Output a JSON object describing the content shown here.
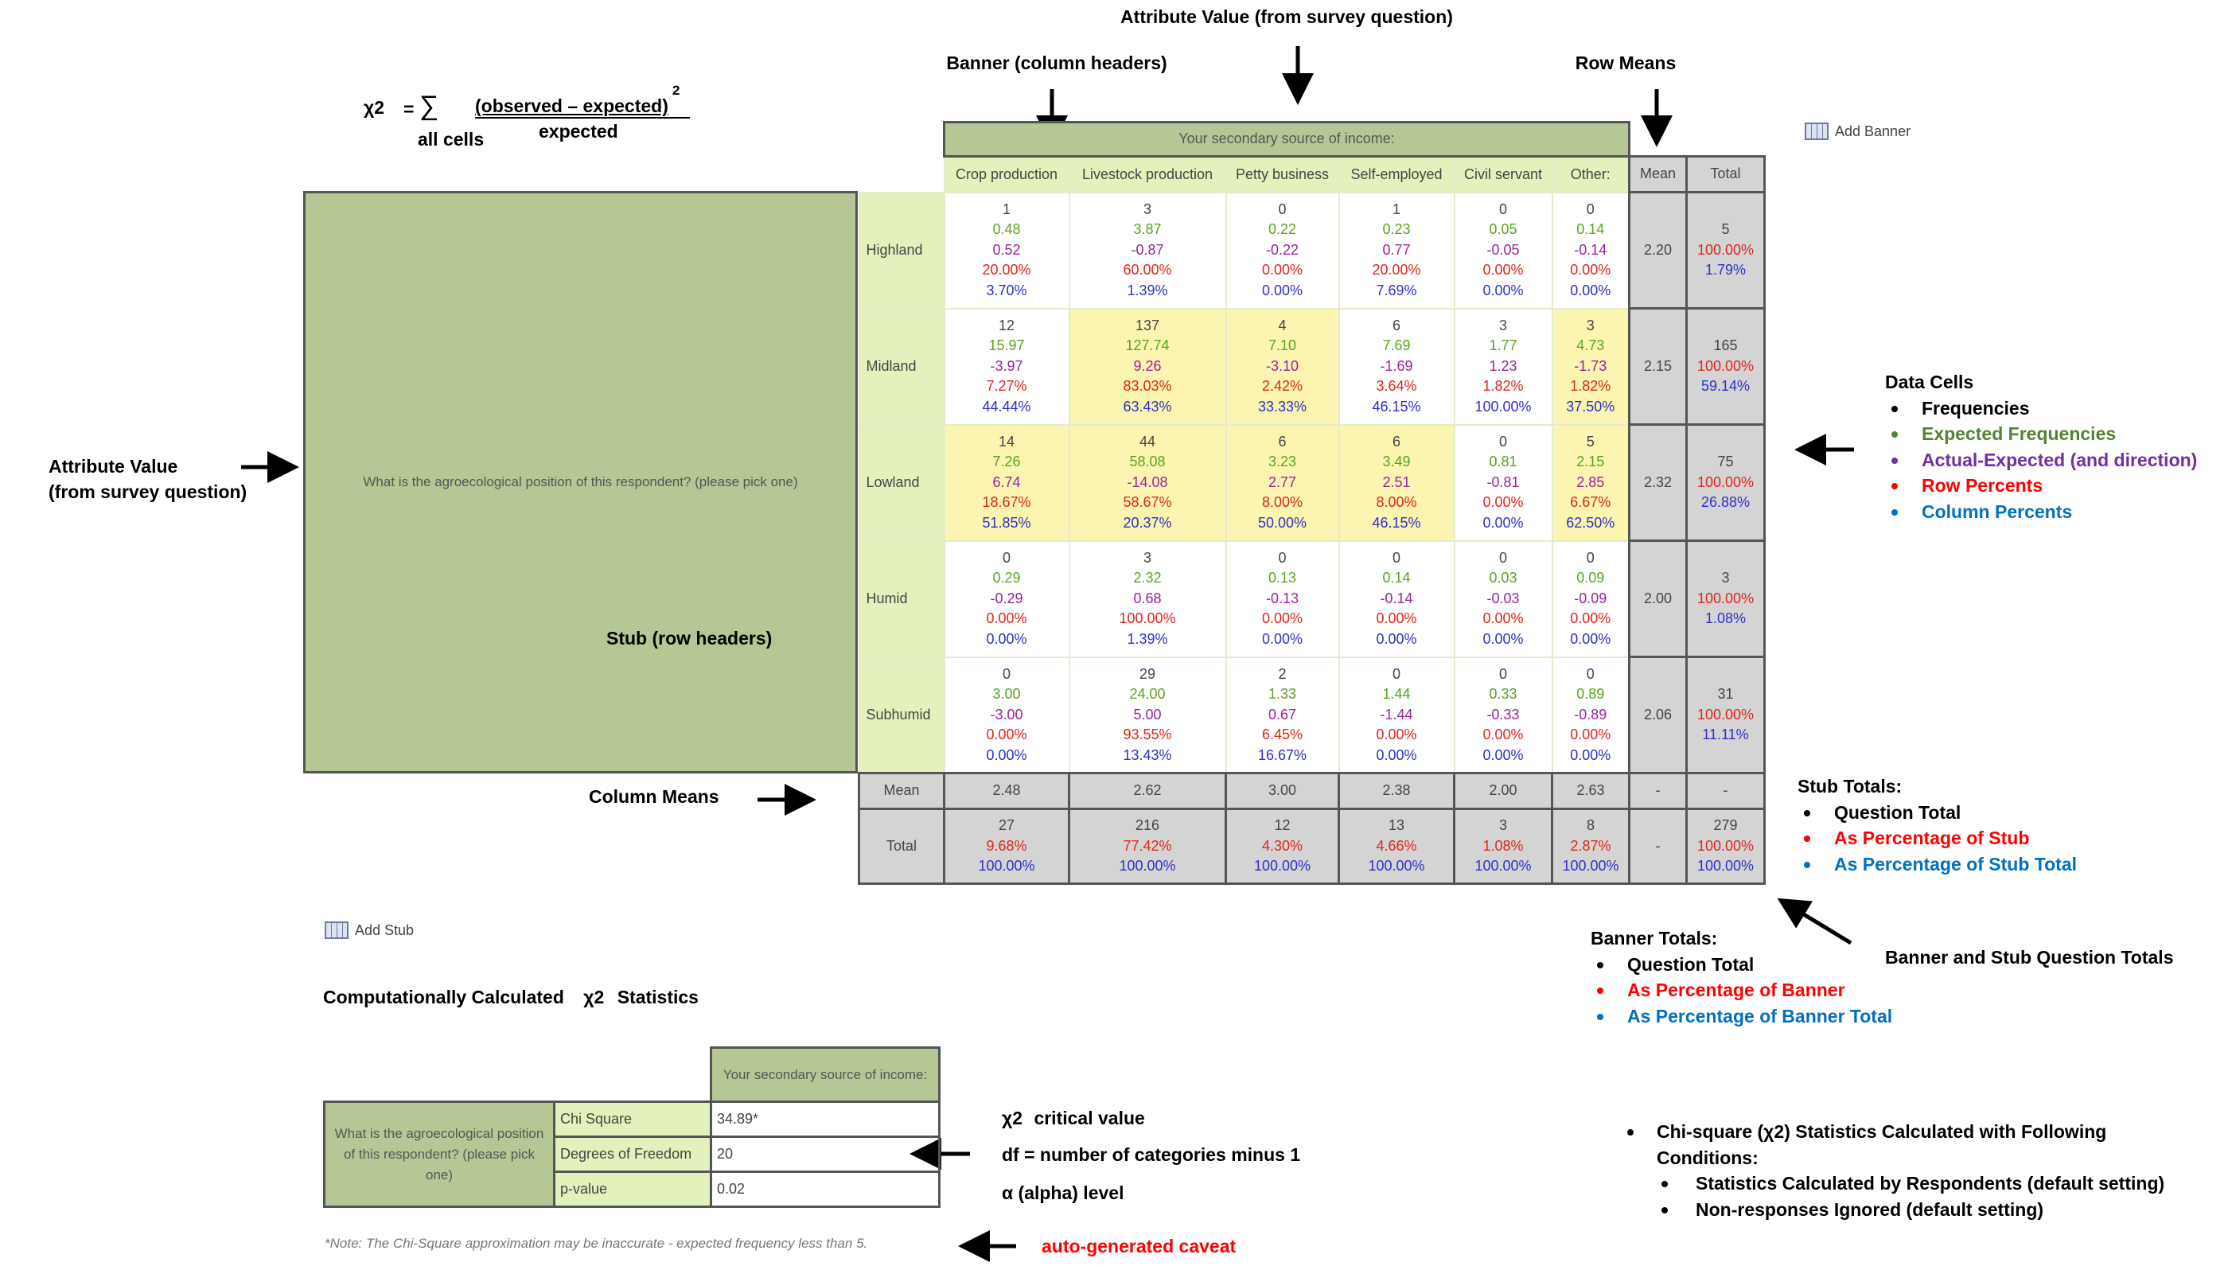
{
  "annotations": {
    "attribute_value_top": "Attribute Value (from survey question)",
    "banner_label": "Banner (column headers)",
    "row_means_label": "Row Means",
    "attribute_value_left": "Attribute Value\n(from survey question)",
    "stub_label": "Stub (row headers)",
    "column_means_label": "Column Means",
    "banner_stub_totals_label": "Banner and Stub Question Totals",
    "computed_stats_label": "Computationally Calculated",
    "computed_stats_symbol": "χ2",
    "computed_stats_suffix": "Statistics",
    "critical_value": "critical value",
    "critical_symbol": "χ2",
    "df_note": "df = number of categories minus 1",
    "alpha_note": "α (alpha) level",
    "caveat_label": "auto-generated caveat"
  },
  "formula": {
    "lhs": "χ2",
    "equals": "=",
    "sum": "∑",
    "sum_under": "all cells",
    "numerator": "(observed – expected)",
    "exponent": "2",
    "denominator": "expected"
  },
  "add_banner_label": "Add Banner",
  "add_stub_label": "Add Stub",
  "crosstab": {
    "banner_title": "Your secondary source of income:",
    "stub_question": "What is the agroecological position of this respondent? (please pick one)",
    "columns": [
      "Crop production",
      "Livestock production",
      "Petty business",
      "Self-employed",
      "Civil servant",
      "Other:"
    ],
    "mean_header": "Mean",
    "total_header": "Total",
    "rows": [
      {
        "label": "Highland",
        "cells": [
          [
            "1",
            "0.48",
            "0.52",
            "20.00%",
            "3.70%"
          ],
          [
            "3",
            "3.87",
            "-0.87",
            "60.00%",
            "1.39%"
          ],
          [
            "0",
            "0.22",
            "-0.22",
            "0.00%",
            "0.00%"
          ],
          [
            "1",
            "0.23",
            "0.77",
            "20.00%",
            "7.69%"
          ],
          [
            "0",
            "0.05",
            "-0.05",
            "0.00%",
            "0.00%"
          ],
          [
            "0",
            "0.14",
            "-0.14",
            "0.00%",
            "0.00%"
          ]
        ],
        "highlight": [
          false,
          false,
          false,
          false,
          false,
          false
        ],
        "mean": "2.20",
        "total": [
          "5",
          "100.00%",
          "1.79%"
        ]
      },
      {
        "label": "Midland",
        "cells": [
          [
            "12",
            "15.97",
            "-3.97",
            "7.27%",
            "44.44%"
          ],
          [
            "137",
            "127.74",
            "9.26",
            "83.03%",
            "63.43%"
          ],
          [
            "4",
            "7.10",
            "-3.10",
            "2.42%",
            "33.33%"
          ],
          [
            "6",
            "7.69",
            "-1.69",
            "3.64%",
            "46.15%"
          ],
          [
            "3",
            "1.77",
            "1.23",
            "1.82%",
            "100.00%"
          ],
          [
            "3",
            "4.73",
            "-1.73",
            "1.82%",
            "37.50%"
          ]
        ],
        "highlight": [
          false,
          true,
          true,
          false,
          false,
          true
        ],
        "mean": "2.15",
        "total": [
          "165",
          "100.00%",
          "59.14%"
        ]
      },
      {
        "label": "Lowland",
        "cells": [
          [
            "14",
            "7.26",
            "6.74",
            "18.67%",
            "51.85%"
          ],
          [
            "44",
            "58.08",
            "-14.08",
            "58.67%",
            "20.37%"
          ],
          [
            "6",
            "3.23",
            "2.77",
            "8.00%",
            "50.00%"
          ],
          [
            "6",
            "3.49",
            "2.51",
            "8.00%",
            "46.15%"
          ],
          [
            "0",
            "0.81",
            "-0.81",
            "0.00%",
            "0.00%"
          ],
          [
            "5",
            "2.15",
            "2.85",
            "6.67%",
            "62.50%"
          ]
        ],
        "highlight": [
          true,
          true,
          true,
          true,
          false,
          true
        ],
        "mean": "2.32",
        "total": [
          "75",
          "100.00%",
          "26.88%"
        ]
      },
      {
        "label": "Humid",
        "cells": [
          [
            "0",
            "0.29",
            "-0.29",
            "0.00%",
            "0.00%"
          ],
          [
            "3",
            "2.32",
            "0.68",
            "100.00%",
            "1.39%"
          ],
          [
            "0",
            "0.13",
            "-0.13",
            "0.00%",
            "0.00%"
          ],
          [
            "0",
            "0.14",
            "-0.14",
            "0.00%",
            "0.00%"
          ],
          [
            "0",
            "0.03",
            "-0.03",
            "0.00%",
            "0.00%"
          ],
          [
            "0",
            "0.09",
            "-0.09",
            "0.00%",
            "0.00%"
          ]
        ],
        "highlight": [
          false,
          false,
          false,
          false,
          false,
          false
        ],
        "mean": "2.00",
        "total": [
          "3",
          "100.00%",
          "1.08%"
        ]
      },
      {
        "label": "Subhumid",
        "cells": [
          [
            "0",
            "3.00",
            "-3.00",
            "0.00%",
            "0.00%"
          ],
          [
            "29",
            "24.00",
            "5.00",
            "93.55%",
            "13.43%"
          ],
          [
            "2",
            "1.33",
            "0.67",
            "6.45%",
            "16.67%"
          ],
          [
            "0",
            "1.44",
            "-1.44",
            "0.00%",
            "0.00%"
          ],
          [
            "0",
            "0.33",
            "-0.33",
            "0.00%",
            "0.00%"
          ],
          [
            "0",
            "0.89",
            "-0.89",
            "0.00%",
            "0.00%"
          ]
        ],
        "highlight": [
          false,
          false,
          false,
          false,
          false,
          false
        ],
        "mean": "2.06",
        "total": [
          "31",
          "100.00%",
          "11.11%"
        ]
      }
    ],
    "mean_row": {
      "label": "Mean",
      "values": [
        "2.48",
        "2.62",
        "3.00",
        "2.38",
        "2.00",
        "2.63"
      ],
      "mean": "-",
      "total": "-"
    },
    "total_row": {
      "label": "Total",
      "values": [
        [
          "27",
          "9.68%",
          "100.00%"
        ],
        [
          "216",
          "77.42%",
          "100.00%"
        ],
        [
          "12",
          "4.30%",
          "100.00%"
        ],
        [
          "13",
          "4.66%",
          "100.00%"
        ],
        [
          "3",
          "1.08%",
          "100.00%"
        ],
        [
          "8",
          "2.87%",
          "100.00%"
        ]
      ],
      "mean": "-",
      "total": [
        "279",
        "100.00%",
        "100.00%"
      ]
    }
  },
  "legend_data_cells": {
    "title": "Data Cells",
    "items": [
      {
        "label": "Frequencies",
        "color": "#000000"
      },
      {
        "label": "Expected Frequencies",
        "color": "#548235"
      },
      {
        "label": "Actual-Expected (and direction)",
        "color": "#7030a0"
      },
      {
        "label": "Row Percents",
        "color": "#ff0000"
      },
      {
        "label": "Column Percents",
        "color": "#0070c0"
      }
    ]
  },
  "legend_stub_totals": {
    "title": "Stub Totals:",
    "items": [
      {
        "label": "Question Total",
        "color": "#000000"
      },
      {
        "label": "As Percentage of Stub",
        "color": "#ff0000"
      },
      {
        "label": "As Percentage of Stub Total",
        "color": "#0070c0"
      }
    ]
  },
  "legend_banner_totals": {
    "title": "Banner Totals:",
    "items": [
      {
        "label": "Question Total",
        "color": "#000000"
      },
      {
        "label": "As Percentage of Banner",
        "color": "#ff0000"
      },
      {
        "label": "As Percentage of Banner Total",
        "color": "#0070c0"
      }
    ]
  },
  "conditions": {
    "main": "Chi-square  (χ2) Statistics Calculated with Following",
    "main2": "Conditions:",
    "items": [
      "Statistics Calculated by Respondents (default setting)",
      "Non-responses Ignored (default setting)"
    ]
  },
  "chi_table": {
    "banner": "Your secondary source of income:",
    "stub": "What is the agroecological position of this respondent? (please pick one)",
    "rows": [
      {
        "label": "Chi Square",
        "value": "34.89*"
      },
      {
        "label": "Degrees of Freedom",
        "value": "20"
      },
      {
        "label": "p-value",
        "value": "0.02"
      }
    ],
    "note": "*Note: The Chi-Square approximation may be inaccurate - expected frequency less than 5."
  },
  "colors": {
    "banner_bg": "#b5c794",
    "header_bg": "#e3f2bc",
    "highlight": "#fcf5b1",
    "summary_bg": "#d4d4d4"
  }
}
